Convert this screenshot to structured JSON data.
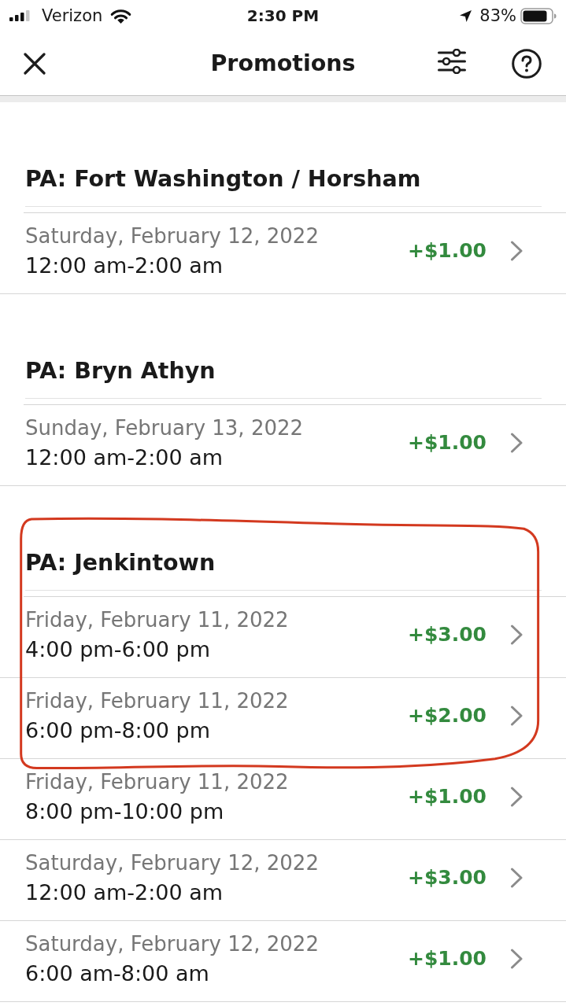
{
  "status_bar": {
    "carrier": "Verizon",
    "time": "2:30 PM",
    "battery": "83%"
  },
  "header": {
    "title": "Promotions"
  },
  "sections": [
    {
      "title": "PA: Fort Washington / Horsham",
      "circled": false,
      "promotions": [
        {
          "date": "Saturday, February 12, 2022",
          "time": "12:00 am-2:00 am",
          "bonus": "+$1.00",
          "circled": false
        }
      ]
    },
    {
      "title": "PA: Bryn Athyn",
      "circled": false,
      "promotions": [
        {
          "date": "Sunday, February 13, 2022",
          "time": "12:00 am-2:00 am",
          "bonus": "+$1.00",
          "circled": false
        }
      ]
    },
    {
      "title": "PA: Jenkintown",
      "circled": true,
      "promotions": [
        {
          "date": "Friday, February 11, 2022",
          "time": "4:00 pm-6:00 pm",
          "bonus": "+$3.00",
          "circled": true
        },
        {
          "date": "Friday, February 11, 2022",
          "time": "6:00 pm-8:00 pm",
          "bonus": "+$2.00",
          "circled": true
        },
        {
          "date": "Friday, February 11, 2022",
          "time": "8:00 pm-10:00 pm",
          "bonus": "+$1.00",
          "circled": false
        },
        {
          "date": "Saturday, February 12, 2022",
          "time": "12:00 am-2:00 am",
          "bonus": "+$3.00",
          "circled": false
        },
        {
          "date": "Saturday, February 12, 2022",
          "time": "6:00 am-8:00 am",
          "bonus": "+$1.00",
          "circled": false
        }
      ]
    }
  ]
}
